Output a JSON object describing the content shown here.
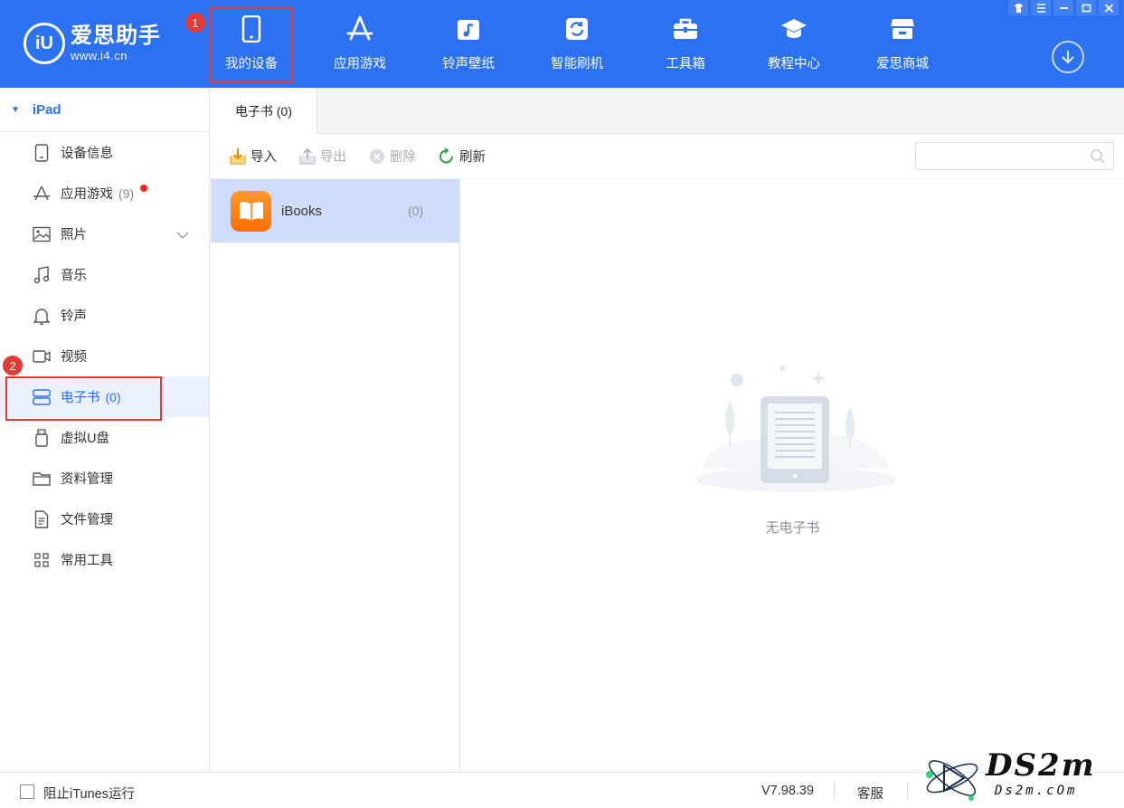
{
  "header": {
    "logo_name": "爱思助手",
    "logo_url": "www.i4.cn",
    "logo_mark": "iU",
    "nav": [
      {
        "label": "我的设备",
        "icon": "phone-icon",
        "active": true
      },
      {
        "label": "应用游戏",
        "icon": "app-store-icon"
      },
      {
        "label": "铃声壁纸",
        "icon": "music-note-icon"
      },
      {
        "label": "智能刷机",
        "icon": "refresh-box-icon"
      },
      {
        "label": "工具箱",
        "icon": "toolbox-icon"
      },
      {
        "label": "教程中心",
        "icon": "graduation-cap-icon"
      },
      {
        "label": "爱思商城",
        "icon": "store-icon"
      }
    ],
    "markers": [
      "1",
      "2"
    ]
  },
  "sidebar": {
    "device": "iPad",
    "items": [
      {
        "label": "设备信息",
        "icon": "tablet-icon"
      },
      {
        "label": "应用游戏",
        "icon": "app-store-icon",
        "count": "(9)",
        "badge": true
      },
      {
        "label": "照片",
        "icon": "image-icon",
        "expandable": true
      },
      {
        "label": "音乐",
        "icon": "music-icon"
      },
      {
        "label": "铃声",
        "icon": "bell-icon"
      },
      {
        "label": "视频",
        "icon": "video-icon"
      },
      {
        "label": "电子书",
        "icon": "ebook-icon",
        "count": "(0)",
        "active": true
      },
      {
        "label": "虚拟U盘",
        "icon": "usb-drive-icon"
      },
      {
        "label": "资料管理",
        "icon": "folder-icon"
      },
      {
        "label": "文件管理",
        "icon": "document-icon"
      },
      {
        "label": "常用工具",
        "icon": "grid-icon"
      }
    ]
  },
  "main": {
    "tab_label": "电子书 (0)",
    "toolbar": {
      "import_label": "导入",
      "export_label": "导出",
      "delete_label": "删除",
      "refresh_label": "刷新",
      "search_placeholder": ""
    },
    "apps": [
      {
        "name": "iBooks",
        "count": "(0)"
      }
    ],
    "empty_text": "无电子书"
  },
  "status": {
    "block_itunes_label": "阻止iTunes运行",
    "version": "V7.98.39",
    "service_label": "客服"
  },
  "watermark": {
    "big": "DS2m",
    "small": "Ds2m.cOm"
  },
  "colors": {
    "brand": "#2b71f2",
    "highlight_border": "#e53935",
    "selected_row": "#cfdcf8"
  }
}
